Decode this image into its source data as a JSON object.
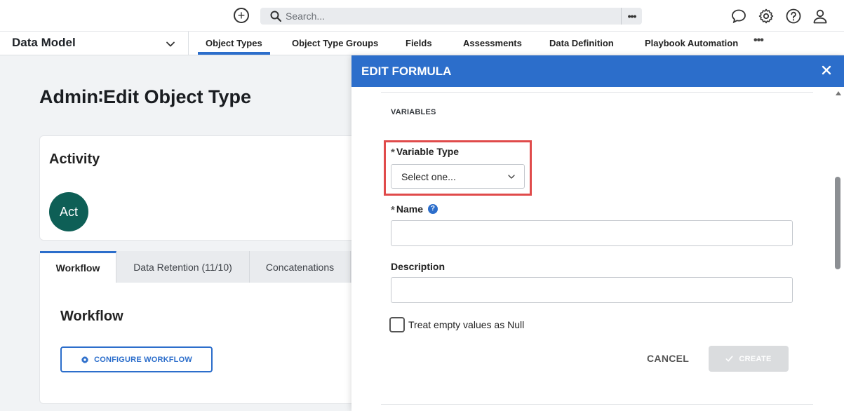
{
  "topbar": {
    "add_icon": "plus-circle-icon",
    "search_placeholder": "Search...",
    "search_more_label": "•••",
    "icons": [
      "chat-icon",
      "gear-icon",
      "help-icon",
      "user-icon"
    ]
  },
  "navbar": {
    "module_label": "Data Model",
    "tabs": [
      {
        "label": "Object Types",
        "active": true
      },
      {
        "label": "Object Type Groups"
      },
      {
        "label": "Fields"
      },
      {
        "label": "Assessments"
      },
      {
        "label": "Data Definition"
      },
      {
        "label": "Playbook Automation"
      }
    ],
    "more_label": "•••"
  },
  "page": {
    "title": "Admin∶Edit Object Type",
    "activity": {
      "title": "Activity",
      "avatar_text": "Act",
      "avatar_color": "#0e5f56"
    },
    "tabs": [
      {
        "label": "Workflow",
        "active": true
      },
      {
        "label": "Data Retention (11/10)"
      },
      {
        "label": "Concatenations"
      }
    ],
    "section_title": "Workflow",
    "configure_button": "CONFIGURE WORKFLOW"
  },
  "modal": {
    "title": "EDIT FORMULA",
    "header_color": "#2c6ecb",
    "section_label": "VARIABLES",
    "variable_type": {
      "required_mark": "*",
      "label": "Variable Type",
      "value": "Select one..."
    },
    "name": {
      "required_mark": "*",
      "label": "Name",
      "help": "?",
      "value": ""
    },
    "description": {
      "label": "Description",
      "value": ""
    },
    "treat_null": {
      "label": "Treat empty values as Null",
      "checked": false
    },
    "cancel_label": "CANCEL",
    "create_label": "CREATE",
    "highlight_color": "#e04b4b"
  }
}
